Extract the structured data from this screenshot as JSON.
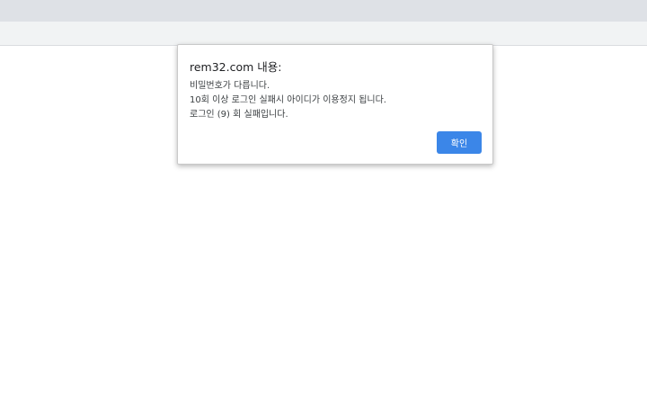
{
  "dialog": {
    "title": "rem32.com 내용:",
    "message_lines": [
      "비밀번호가 다릅니다.",
      "10회 이상 로그인 실패시 아이디가 이용정지 됩니다.",
      "로그인 (9) 회 실패입니다."
    ],
    "ok_label": "확인"
  },
  "colors": {
    "ok_button": "#3b86e8",
    "tabstrip": "#dee1e6",
    "toolbar": "#f1f3f4"
  }
}
